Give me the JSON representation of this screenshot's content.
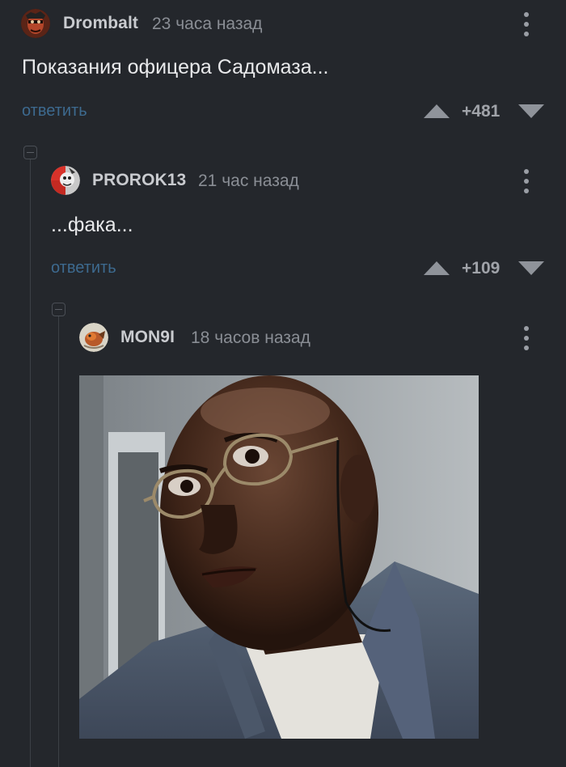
{
  "comments": [
    {
      "username": "Drombalt",
      "timestamp": "23 часа назад",
      "text": "Показания офицера Садомаза...",
      "reply_label": "ответить",
      "rating": "+481",
      "avatar_icon": "user-avatar-icon"
    },
    {
      "username": "PROROK13",
      "timestamp": "21 час назад",
      "text": "...фака...",
      "reply_label": "ответить",
      "rating": "+109",
      "avatar_icon": "user-avatar-icon"
    },
    {
      "username": "MON9I",
      "timestamp": "18 часов назад",
      "avatar_icon": "user-avatar-icon"
    }
  ],
  "icons": {
    "more": "more-vertical-icon",
    "upvote": "arrow-up-icon",
    "downvote": "arrow-down-icon",
    "collapse": "collapse-thread-icon"
  },
  "colors": {
    "background": "#24272c",
    "link": "#3d6a8f",
    "vote_arrow": "#8f939a",
    "thread_line": "#3c4046"
  }
}
